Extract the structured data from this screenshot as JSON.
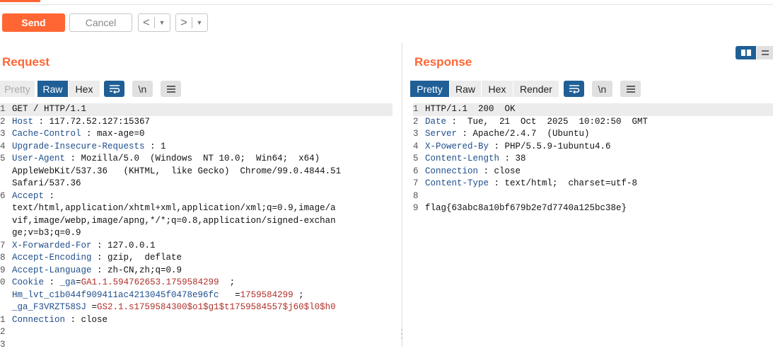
{
  "toolbar": {
    "send_label": "Send",
    "cancel_label": "Cancel",
    "back_arrow": "<",
    "forward_arrow": ">",
    "dropdown_glyph": "▼"
  },
  "request": {
    "title": "Request",
    "tabs": {
      "pretty": "Pretty",
      "raw": "Raw",
      "hex": "Hex"
    },
    "active_tab": "Raw",
    "newline_label": "\\n",
    "lines": [
      {
        "n": "1",
        "parts": [
          {
            "t": "GET / HTTP/1.1",
            "c": "v"
          }
        ],
        "hl": true
      },
      {
        "n": "2",
        "parts": [
          {
            "t": "Host",
            "c": "k"
          },
          {
            "t": " : 117.72.52.127:15367",
            "c": "v"
          }
        ]
      },
      {
        "n": "3",
        "parts": [
          {
            "t": "Cache-Control",
            "c": "k"
          },
          {
            "t": " : max-age=0",
            "c": "v"
          }
        ]
      },
      {
        "n": "4",
        "parts": [
          {
            "t": "Upgrade-Insecure-Requests",
            "c": "k"
          },
          {
            "t": " : 1",
            "c": "v"
          }
        ]
      },
      {
        "n": "5",
        "parts": [
          {
            "t": "User-Agent",
            "c": "k"
          },
          {
            "t": " : Mozilla/5.0  (Windows  NT 10.0;  Win64;  x64)",
            "c": "v"
          }
        ]
      },
      {
        "n": "",
        "parts": [
          {
            "t": "AppleWebKit/537.36   (KHTML,  like Gecko)  Chrome/99.0.4844.51",
            "c": "v"
          }
        ]
      },
      {
        "n": "",
        "parts": [
          {
            "t": "Safari/537.36",
            "c": "v"
          }
        ]
      },
      {
        "n": "6",
        "parts": [
          {
            "t": "Accept",
            "c": "k"
          },
          {
            "t": " :",
            "c": "v"
          }
        ]
      },
      {
        "n": "",
        "parts": [
          {
            "t": "text/html,application/xhtml+xml,application/xml;q=0.9,image/a",
            "c": "v"
          }
        ]
      },
      {
        "n": "",
        "parts": [
          {
            "t": "vif,image/webp,image/apng,*/*;q=0.8,application/signed-exchan",
            "c": "v"
          }
        ]
      },
      {
        "n": "",
        "parts": [
          {
            "t": "ge;v=b3;q=0.9",
            "c": "v"
          }
        ]
      },
      {
        "n": "7",
        "parts": [
          {
            "t": "X-Forwarded-For",
            "c": "k"
          },
          {
            "t": " : 127.0.0.1",
            "c": "v"
          }
        ]
      },
      {
        "n": "8",
        "parts": [
          {
            "t": "Accept-Encoding",
            "c": "k"
          },
          {
            "t": " : gzip,  deflate",
            "c": "v"
          }
        ]
      },
      {
        "n": "9",
        "parts": [
          {
            "t": "Accept-Language",
            "c": "k"
          },
          {
            "t": " : zh-CN,zh;q=0.9",
            "c": "v"
          }
        ]
      },
      {
        "n": "0",
        "parts": [
          {
            "t": "Cookie",
            "c": "k"
          },
          {
            "t": " : ",
            "c": "v"
          },
          {
            "t": "_ga",
            "c": "k"
          },
          {
            "t": "=",
            "c": "v"
          },
          {
            "t": "GA1.1.594762653.1759584299",
            "c": "r"
          },
          {
            "t": "  ;",
            "c": "v"
          }
        ]
      },
      {
        "n": "",
        "parts": [
          {
            "t": "Hm_lvt_c1b044f909411ac4213045f0478e96fc",
            "c": "k"
          },
          {
            "t": "   =",
            "c": "v"
          },
          {
            "t": "1759584299",
            "c": "r"
          },
          {
            "t": " ;",
            "c": "v"
          }
        ]
      },
      {
        "n": "",
        "parts": [
          {
            "t": "_ga_F3VRZT58SJ",
            "c": "k"
          },
          {
            "t": " =",
            "c": "v"
          },
          {
            "t": "GS2.1.s1759584300$o1$g1$t1759584557$j60$l0$h0",
            "c": "r"
          }
        ]
      },
      {
        "n": "1",
        "parts": [
          {
            "t": "Connection",
            "c": "k"
          },
          {
            "t": " : close",
            "c": "v"
          }
        ]
      },
      {
        "n": "2",
        "parts": []
      },
      {
        "n": "3",
        "parts": []
      }
    ]
  },
  "response": {
    "title": "Response",
    "tabs": {
      "pretty": "Pretty",
      "raw": "Raw",
      "hex": "Hex",
      "render": "Render"
    },
    "active_tab": "Pretty",
    "newline_label": "\\n",
    "lines": [
      {
        "n": "1",
        "parts": [
          {
            "t": "HTTP/1.1  200  OK",
            "c": "v"
          }
        ],
        "hl": true
      },
      {
        "n": "2",
        "parts": [
          {
            "t": "Date",
            "c": "k"
          },
          {
            "t": " :  Tue,  21  Oct  2025  10:02:50  GMT",
            "c": "v"
          }
        ]
      },
      {
        "n": "3",
        "parts": [
          {
            "t": "Server",
            "c": "k"
          },
          {
            "t": " : Apache/2.4.7  (Ubuntu)",
            "c": "v"
          }
        ]
      },
      {
        "n": "4",
        "parts": [
          {
            "t": "X-Powered-By",
            "c": "k"
          },
          {
            "t": " : PHP/5.5.9-1ubuntu4.6",
            "c": "v"
          }
        ]
      },
      {
        "n": "5",
        "parts": [
          {
            "t": "Content-Length",
            "c": "k"
          },
          {
            "t": " : 38",
            "c": "v"
          }
        ]
      },
      {
        "n": "6",
        "parts": [
          {
            "t": "Connection",
            "c": "k"
          },
          {
            "t": " : close",
            "c": "v"
          }
        ]
      },
      {
        "n": "7",
        "parts": [
          {
            "t": "Content-Type",
            "c": "k"
          },
          {
            "t": " : text/html;  charset=utf-8",
            "c": "v"
          }
        ]
      },
      {
        "n": "8",
        "parts": []
      },
      {
        "n": "9",
        "parts": [
          {
            "t": "flag{63abc8a10bf679b2e7d7740a125bc38e}",
            "c": "v"
          }
        ]
      }
    ]
  },
  "colors": {
    "accent": "#ff6633",
    "active_blue": "#1f5f96",
    "header_key": "#1f4e8c",
    "cookie_value": "#b0302a"
  },
  "icons": [
    "wrap-lines-icon",
    "menu-icon",
    "layout-split-icon",
    "layout-stack-icon"
  ]
}
